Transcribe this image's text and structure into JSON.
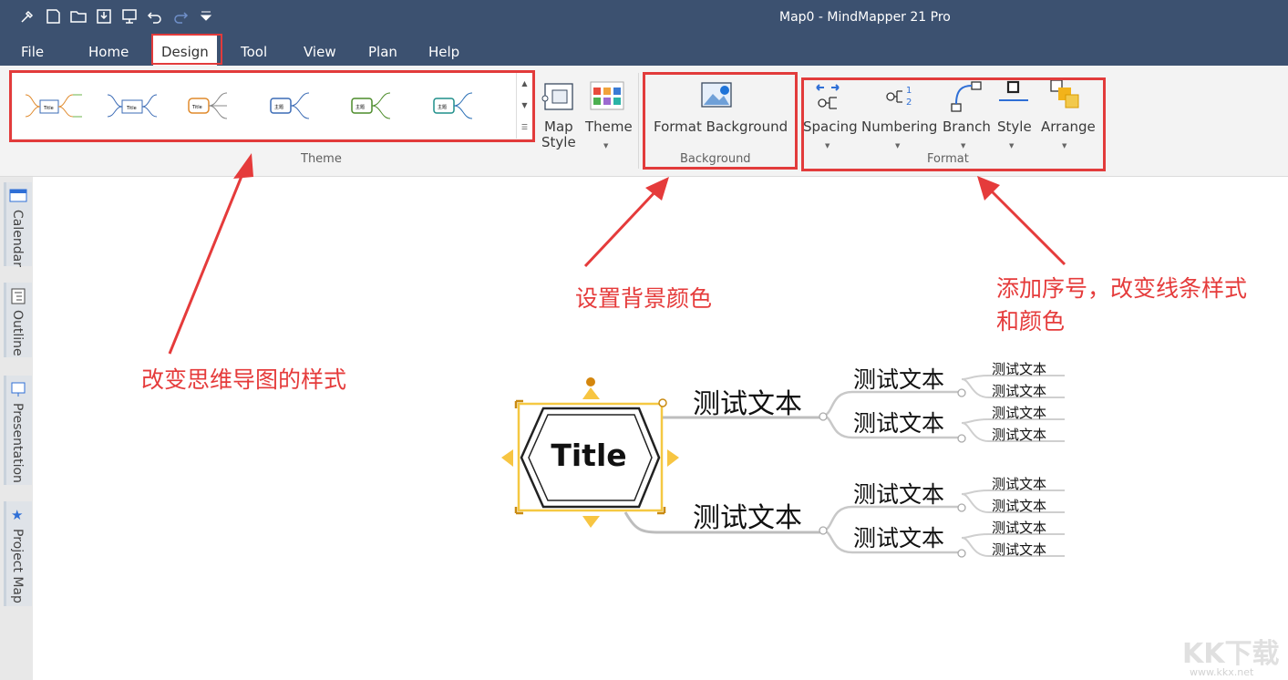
{
  "window": {
    "title": "Map0 -  MindMapper 21 Pro"
  },
  "quick_access": [
    "brush-icon",
    "new-icon",
    "open-icon",
    "save-icon",
    "present-icon",
    "undo-icon",
    "redo-icon",
    "dropdown-icon"
  ],
  "menu": {
    "items": [
      "File",
      "Home",
      "Design",
      "Tool",
      "View",
      "Plan",
      "Help"
    ],
    "active": "Design"
  },
  "ribbon": {
    "theme_group": {
      "label": "Theme",
      "thumbnail_titles": [
        "Title",
        "Title",
        "Title",
        "主题",
        "主题",
        "主题"
      ]
    },
    "map_style": {
      "line1": "Map",
      "line2": "Style"
    },
    "theme_button": {
      "label": "Theme"
    },
    "background_group": {
      "label": "Background",
      "button": "Format Background"
    },
    "format_group": {
      "label": "Format",
      "buttons": [
        "Spacing",
        "Numbering",
        "Branch",
        "Style",
        "Arrange"
      ]
    }
  },
  "sidebar": {
    "tabs": [
      "Calendar",
      "Outline",
      "Presentation",
      "Project Map"
    ]
  },
  "annotations": {
    "theme": "改变思维导图的样式",
    "background": "设置背景颜色",
    "format_line1": "添加序号，改变线条样式",
    "format_line2": "和颜色"
  },
  "mindmap": {
    "central": "Title",
    "branches": [
      {
        "text": "测试文本",
        "children": [
          {
            "text": "测试文本",
            "children": [
              "测试文本",
              "测试文本"
            ]
          },
          {
            "text": "测试文本",
            "children": [
              "测试文本",
              "测试文本"
            ]
          }
        ]
      },
      {
        "text": "测试文本",
        "children": [
          {
            "text": "测试文本",
            "children": [
              "测试文本",
              "测试文本"
            ]
          },
          {
            "text": "测试文本",
            "children": [
              "测试文本",
              "测试文本"
            ]
          }
        ]
      }
    ]
  },
  "watermark": {
    "logo": "KK下载",
    "site": "www.kkx.net"
  },
  "colors": {
    "titlebar": "#3c5170",
    "annotation": "#e53b3b",
    "selection": "#f5c842"
  }
}
